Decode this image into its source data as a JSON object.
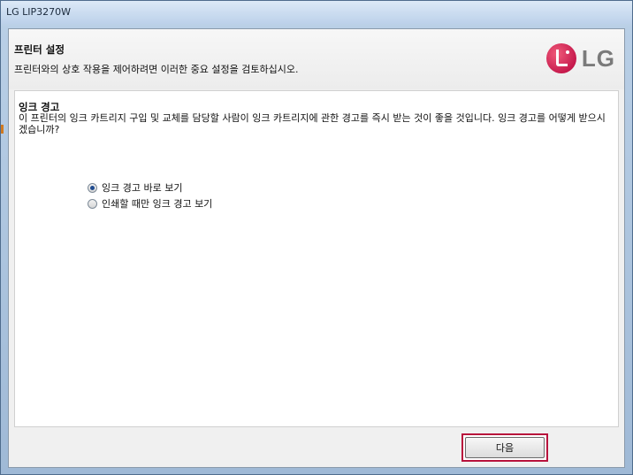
{
  "window": {
    "title": "LG LIP3270W"
  },
  "header": {
    "title": "프린터 설정",
    "subtitle": "프린터와의 상호 작용을 제어하려면 이러한 중요 설정을 검토하십시오.",
    "logo_text": "LG"
  },
  "section": {
    "title": "잉크 경고",
    "description": "이 프린터의 잉크 카트리지 구입 및 교체를 담당할 사람이 잉크 카트리지에 관한 경고를 즉시 받는 것이 좋을 것입니다. 잉크 경고를 어떻게 받으시겠습니까?"
  },
  "options": [
    {
      "label": "잉크 경고 바로 보기",
      "selected": true
    },
    {
      "label": "인쇄할 때만 잉크 경고 보기",
      "selected": false
    }
  ],
  "footer": {
    "next_label": "다음"
  },
  "colors": {
    "highlight": "#b8123c",
    "logo_red": "#b5003a"
  }
}
